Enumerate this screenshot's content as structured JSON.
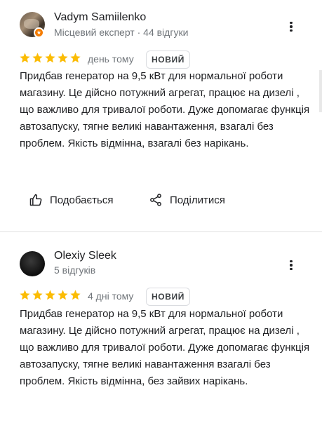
{
  "reviews": [
    {
      "author": "Vadym Samiilenko",
      "meta": "Місцевий експерт · 44 відгуки",
      "local_guide_badge": "★",
      "rating": 5,
      "date": "день тому",
      "badge": "НОВИЙ",
      "text": "Придбав генератор на 9,5 кВт для нормальної роботи магазину. Це дійсно потужний агрегат, працює на дизелі , що важливо для тривалої роботи. Дуже допомагає функція автозапуску, тягне великі навантаження, взагалі без проблем. Якість відмінна, взагалі без нарікань.",
      "like_label": "Подобається",
      "share_label": "Поділитися"
    },
    {
      "author": "Olexiy Sleek",
      "meta": "5 відгуків",
      "rating": 5,
      "date": "4 дні тому",
      "badge": "НОВИЙ",
      "text": "Придбав генератор на 9,5 кВт для нормальної роботи магазину. Це дійсно потужний агрегат, працює на дизелі , що важливо для тривалої роботи. Дуже допомагає функція автозапуску, тягне великі навантаження взагалі без проблем. Якість відмінна, без зайвих нарікань."
    }
  ],
  "colors": {
    "star": "#fbbc04",
    "badge_orange": "#f57c00",
    "secondary_text": "#70757a"
  },
  "icons": {
    "more": "more-vert-icon",
    "like": "thumb-up-icon",
    "share": "share-icon",
    "star": "star-icon"
  }
}
